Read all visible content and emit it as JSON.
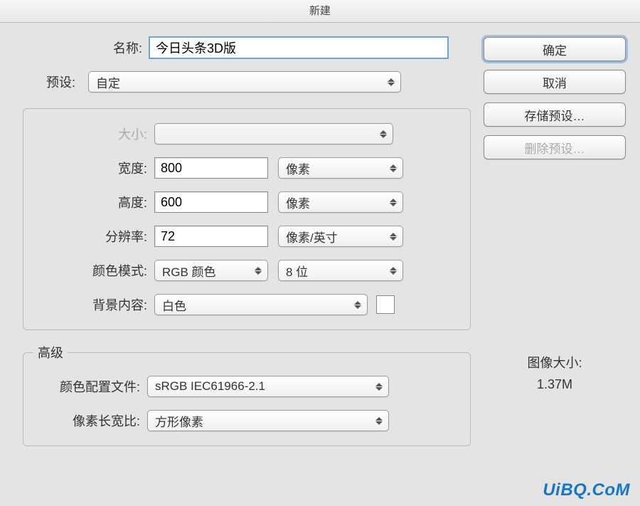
{
  "titlebar": "新建",
  "labels": {
    "name": "名称:",
    "preset": "预设:",
    "size": "大小:",
    "width": "宽度:",
    "height": "高度:",
    "resolution": "分辨率:",
    "color_mode": "颜色模式:",
    "bg": "背景内容:",
    "advanced": "高级",
    "profile": "颜色配置文件:",
    "aspect": "像素长宽比:"
  },
  "values": {
    "name": "今日头条3D版",
    "preset": "自定",
    "size": "",
    "width": "800",
    "height": "600",
    "resolution": "72",
    "width_unit": "像素",
    "height_unit": "像素",
    "res_unit": "像素/英寸",
    "color_mode": "RGB 颜色",
    "bits": "8 位",
    "bg": "白色",
    "profile": "sRGB IEC61966-2.1",
    "aspect": "方形像素"
  },
  "buttons": {
    "ok": "确定",
    "cancel": "取消",
    "save_preset": "存储预设…",
    "delete_preset": "删除预设…"
  },
  "image_size": {
    "label": "图像大小:",
    "value": "1.37M"
  },
  "watermark": "UiBQ.CoM"
}
